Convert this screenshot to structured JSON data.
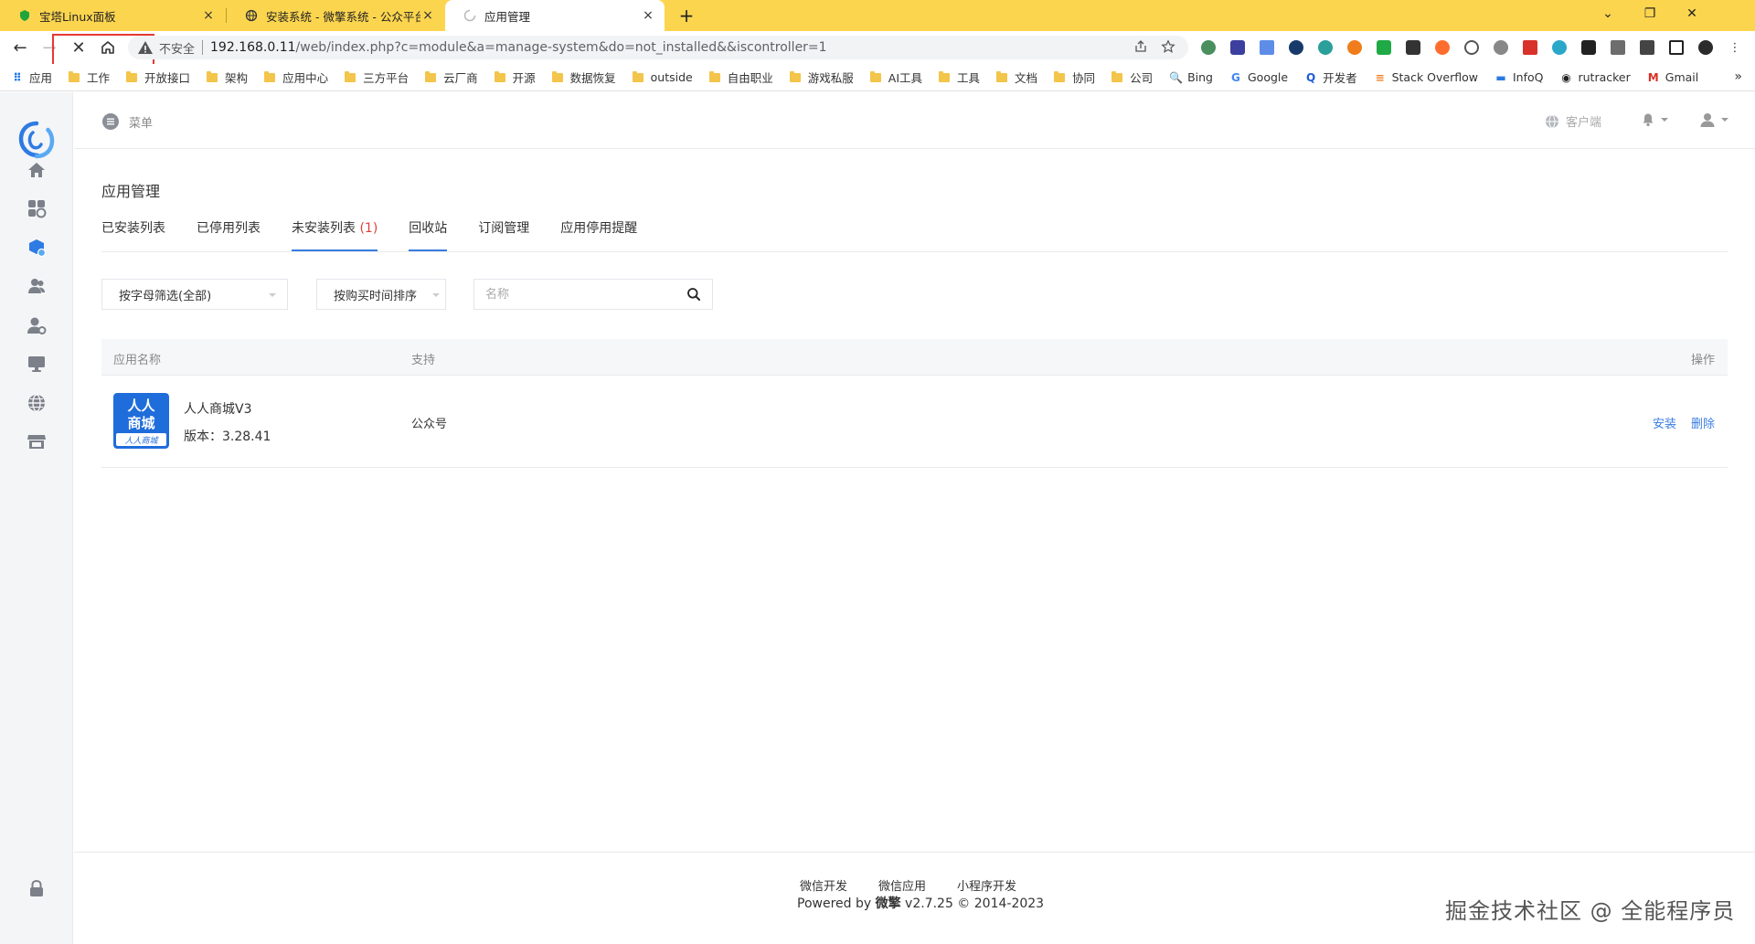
{
  "browser": {
    "tabs": [
      {
        "title": "宝塔Linux面板",
        "close": "×"
      },
      {
        "title": "安装系统 - 微擎系统 - 公众平台自",
        "close": "×"
      },
      {
        "title": "应用管理",
        "close": "×"
      }
    ],
    "new_tab": "+",
    "window_controls": {
      "minimize": "⌄",
      "restore": "❐",
      "close": "✕"
    },
    "nav": {
      "back": "←",
      "forward": "→",
      "stop": "✕",
      "home": "⌂"
    },
    "insecure_label": "不安全",
    "url_host": "192.168.0.11",
    "url_path": "/web/index.php?c=module&a=manage-system&do=not_installed&&iscontroller=1",
    "bookmarks": [
      {
        "label": "应用",
        "kind": "apps"
      },
      {
        "label": "工作",
        "kind": "folder"
      },
      {
        "label": "开放接口",
        "kind": "folder"
      },
      {
        "label": "架构",
        "kind": "folder"
      },
      {
        "label": "应用中心",
        "kind": "folder"
      },
      {
        "label": "三方平台",
        "kind": "folder"
      },
      {
        "label": "云厂商",
        "kind": "folder"
      },
      {
        "label": "开源",
        "kind": "folder"
      },
      {
        "label": "数据恢复",
        "kind": "folder"
      },
      {
        "label": "outside",
        "kind": "folder"
      },
      {
        "label": "自由职业",
        "kind": "folder"
      },
      {
        "label": "游戏私服",
        "kind": "folder"
      },
      {
        "label": "AI工具",
        "kind": "folder"
      },
      {
        "label": "工具",
        "kind": "folder"
      },
      {
        "label": "文档",
        "kind": "folder"
      },
      {
        "label": "协同",
        "kind": "folder"
      },
      {
        "label": "公司",
        "kind": "folder"
      },
      {
        "label": "Bing",
        "kind": "site",
        "glyph": "🔍",
        "color": "#2b6cd9"
      },
      {
        "label": "Google",
        "kind": "site",
        "glyph": "G",
        "color": "#4285f4"
      },
      {
        "label": "开发者",
        "kind": "site",
        "glyph": "Q",
        "color": "#1e5bd6"
      },
      {
        "label": "Stack Overflow",
        "kind": "site",
        "glyph": "≡",
        "color": "#f48024"
      },
      {
        "label": "InfoQ",
        "kind": "site",
        "glyph": "▬",
        "color": "#2a7ae2"
      },
      {
        "label": "rutracker",
        "kind": "site",
        "glyph": "◉",
        "color": "#222"
      },
      {
        "label": "Gmail",
        "kind": "site",
        "glyph": "M",
        "color": "#d93025"
      }
    ],
    "bookmarks_more": "»"
  },
  "topbar": {
    "menu_label": "菜单",
    "client_label": "客户端"
  },
  "page": {
    "title": "应用管理",
    "tabs": [
      {
        "label": "已安装列表",
        "count": ""
      },
      {
        "label": "已停用列表",
        "count": ""
      },
      {
        "label": "未安装列表",
        "count": "(1)"
      },
      {
        "label": "回收站",
        "count": ""
      },
      {
        "label": "订阅管理",
        "count": ""
      },
      {
        "label": "应用停用提醒",
        "count": ""
      }
    ],
    "filters": {
      "letter_filter": "按字母筛选(全部)",
      "sort_filter": "按购买时间排序",
      "search_placeholder": "名称"
    },
    "table": {
      "headers": {
        "name": "应用名称",
        "support": "支持",
        "actions": "操作"
      },
      "rows": [
        {
          "logo_top": "人人",
          "logo_mid": "商城",
          "logo_bottom": "人人商城",
          "name": "人人商城V3",
          "version": "版本：3.28.41",
          "support": "公众号",
          "install": "安装",
          "delete": "删除"
        }
      ]
    }
  },
  "footer": {
    "links": [
      "微信开发",
      "微信应用",
      "小程序开发"
    ],
    "powered_prefix": "Powered by ",
    "powered_brand": "微擎",
    "powered_suffix": " v2.7.25 © 2014-2023"
  },
  "watermark": "掘金技术社区 @ 全能程序员",
  "colors": {
    "tabbar": "#fcd54f",
    "accent": "#3a7de1",
    "count_red": "#e0413a",
    "sidebar": "#f4f5f7"
  }
}
